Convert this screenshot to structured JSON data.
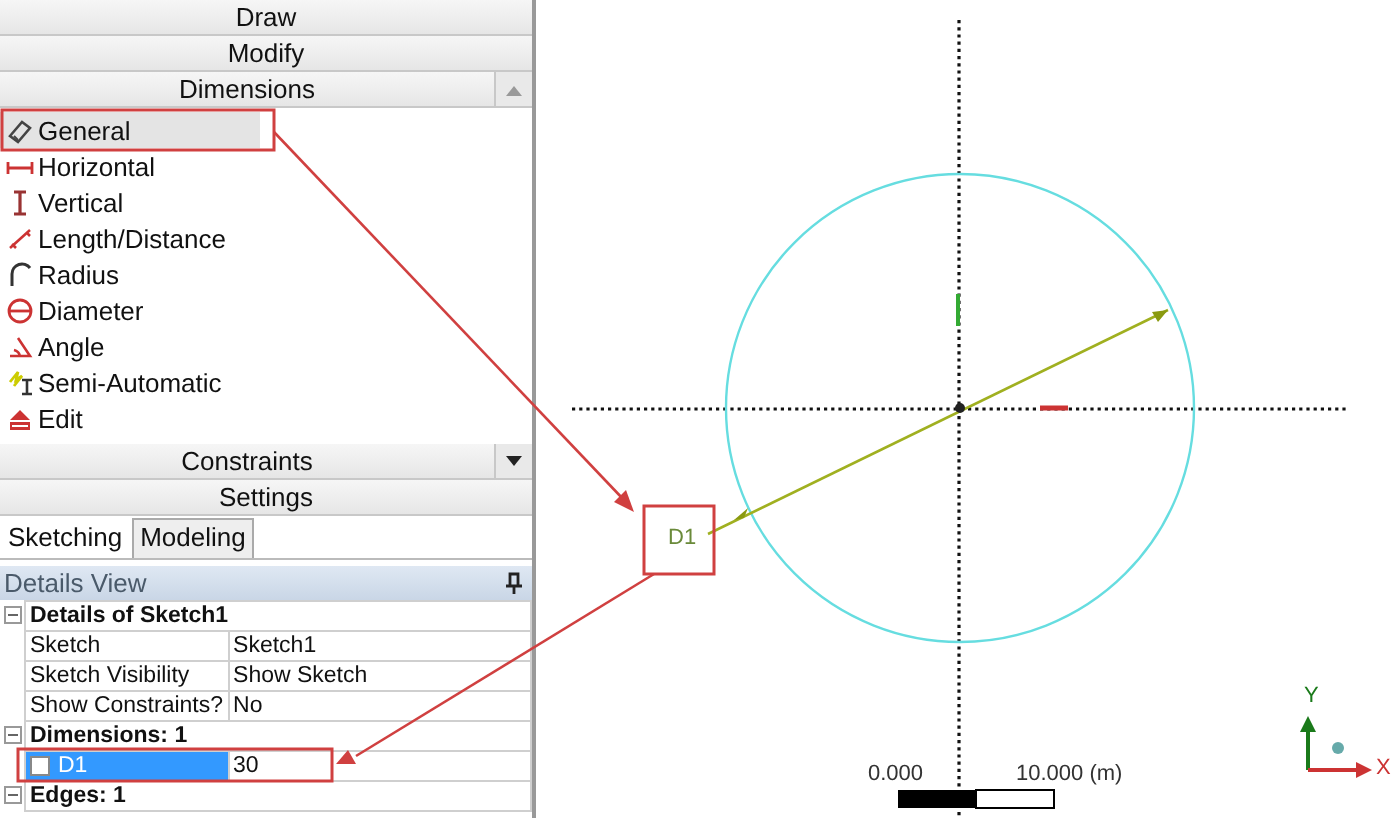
{
  "toolbox": {
    "sections_top": [
      {
        "label": "Draw"
      },
      {
        "label": "Modify"
      },
      {
        "label": "Dimensions",
        "expanded": true
      }
    ],
    "tools": [
      {
        "label": "General",
        "selected": true
      },
      {
        "label": "Horizontal",
        "selected": false
      },
      {
        "label": "Vertical",
        "selected": false
      },
      {
        "label": "Length/Distance",
        "selected": false
      },
      {
        "label": "Radius",
        "selected": false
      },
      {
        "label": "Diameter",
        "selected": false
      },
      {
        "label": "Angle",
        "selected": false
      },
      {
        "label": "Semi-Automatic",
        "selected": false
      },
      {
        "label": "Edit",
        "selected": false
      }
    ],
    "sections_bottom": [
      {
        "label": "Constraints",
        "expanded": false
      },
      {
        "label": "Settings"
      }
    ]
  },
  "tabs": [
    {
      "label": "Sketching",
      "selected": true
    },
    {
      "label": "Modeling",
      "selected": false
    }
  ],
  "details": {
    "title": "Details View",
    "rows": [
      {
        "kind": "group",
        "label": "Details of Sketch1",
        "expanded": true
      },
      {
        "kind": "property",
        "label": "Sketch",
        "value": "Sketch1"
      },
      {
        "kind": "property",
        "label": "Sketch Visibility",
        "value": "Show Sketch"
      },
      {
        "kind": "property",
        "label": "Show Constraints?",
        "value": "No"
      },
      {
        "kind": "group",
        "label": "Dimensions: 1",
        "expanded": true
      },
      {
        "kind": "dimension",
        "label": "D1",
        "value": "30",
        "selected": true,
        "checked": false
      },
      {
        "kind": "group",
        "label": "Edges: 1",
        "expanded": true
      }
    ]
  },
  "canvas": {
    "dimension_label": "D1",
    "scale_start": "0.000",
    "scale_end": "10.000 (m)",
    "axis_y": "Y",
    "axis_x": "X"
  }
}
